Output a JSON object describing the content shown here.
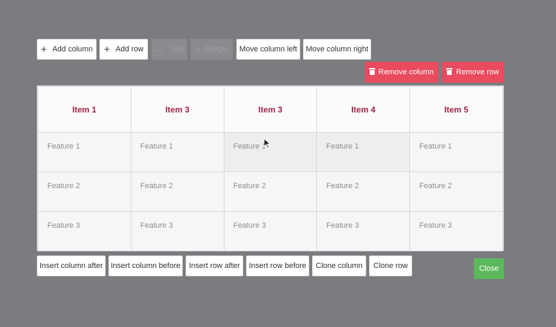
{
  "toolbar_top": {
    "add_column": "Add column",
    "add_row": "Add row",
    "split": "Split",
    "merge": "Merge",
    "move_column_left": "Move column left",
    "move_column_right": "Move column right"
  },
  "toolbar_right": {
    "remove_column": "Remove column",
    "remove_row": "Remove row"
  },
  "table": {
    "headers": [
      "Item 1",
      "Item 3",
      "Item 3",
      "Item 4",
      "Item 5"
    ],
    "rows": [
      [
        "Feature 1",
        "Feature 1",
        "Feature 1",
        "Feature 1",
        "Feature 1"
      ],
      [
        "Feature 2",
        "Feature 2",
        "Feature 2",
        "Feature 2",
        "Feature 2"
      ],
      [
        "Feature 3",
        "Feature 3",
        "Feature 3",
        "Feature 3",
        "Feature 3"
      ]
    ]
  },
  "toolbar_bottom": {
    "insert_column_after": "Insert column after",
    "insert_column_before": "Insert column before",
    "insert_row_after": "Insert row after",
    "insert_row_before": "Insert row before",
    "clone_column": "Clone column",
    "clone_row": "Clone row",
    "close": "Close"
  },
  "icons": {
    "add": "plus-icon",
    "remove": "trash-icon",
    "cursor": "mouse-pointer-icon"
  },
  "colors": {
    "background": "#7b7c80",
    "header_text": "#9b2443",
    "danger": "#e94b5f",
    "success": "#5cb85c"
  }
}
